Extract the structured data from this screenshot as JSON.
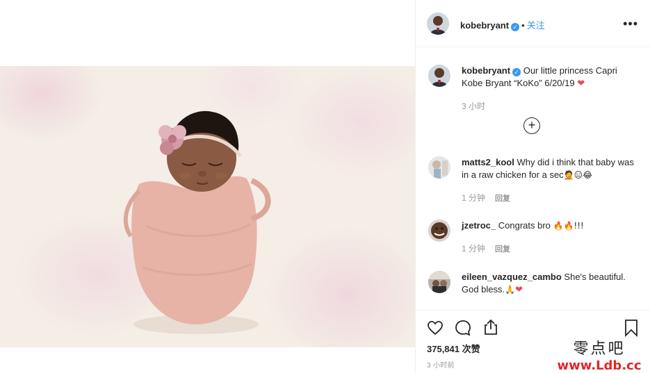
{
  "post": {
    "author": "kobebryant",
    "follow_label": "关注",
    "dot": "•",
    "more_label": "•••",
    "caption": "Our little princess Capri Kobe Bryant “KoKo” 6/20/19",
    "caption_heart": "❤",
    "caption_time": "3 小时",
    "load_more_icon": "plus-circle-icon",
    "photo_alt": "newborn baby wrapped in pink cloth with floral headband"
  },
  "comments": [
    {
      "user": "matts2_kool",
      "text": "Why did i think that baby was in a raw chicken for a sec",
      "emoji": "🤦😑😂",
      "time": "1 分钟",
      "reply": "回复"
    },
    {
      "user": "jzetroc_",
      "text": "Congrats bro",
      "emoji": "🔥🔥!!!",
      "time": "1 分钟",
      "reply": "回复"
    },
    {
      "user": "eileen_vazquez_cambo",
      "text": "She's beautiful. God bless.",
      "emoji": "🙏",
      "heart": "❤"
    }
  ],
  "footer": {
    "likes": "375,841 次赞",
    "timestamp": "3 小时前"
  },
  "watermark": {
    "line1": "零点吧",
    "line2": "www.Ldb.cc"
  },
  "colors": {
    "accent": "#3897f0",
    "heart": "#ed4956",
    "watermark_red": "#e0262a"
  }
}
